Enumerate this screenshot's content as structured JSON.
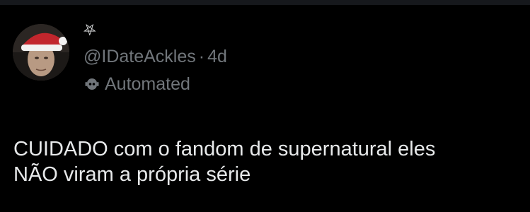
{
  "colors": {
    "background": "#000000",
    "primary_text": "#e7e9ea",
    "secondary_text": "#71767b"
  },
  "post": {
    "display_name": "⛧",
    "handle": "@IDateAckles",
    "separator": "·",
    "time": "4d",
    "automated_icon": "bot-icon",
    "automated_label": "Automated",
    "text_lines": [
      "CUIDADO com o fandom de supernatural eles",
      "NÃO viram a própria série"
    ]
  }
}
